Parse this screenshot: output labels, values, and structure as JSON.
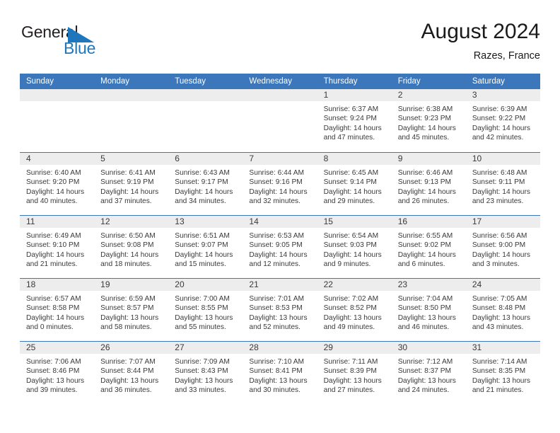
{
  "brand": {
    "name_part1": "General",
    "name_part2": "Blue",
    "color_dark": "#231f20",
    "color_blue": "#1e77bc"
  },
  "header": {
    "title": "August 2024",
    "location": "Razes, France"
  },
  "theme": {
    "header_blue": "#3b77ba",
    "day_band_gray": "#ededed",
    "text": "#3a3a3a"
  },
  "weekdays": [
    "Sunday",
    "Monday",
    "Tuesday",
    "Wednesday",
    "Thursday",
    "Friday",
    "Saturday"
  ],
  "weeks": [
    [
      {
        "day": "",
        "sunrise": "",
        "sunset": "",
        "daylight1": "",
        "daylight2": ""
      },
      {
        "day": "",
        "sunrise": "",
        "sunset": "",
        "daylight1": "",
        "daylight2": ""
      },
      {
        "day": "",
        "sunrise": "",
        "sunset": "",
        "daylight1": "",
        "daylight2": ""
      },
      {
        "day": "",
        "sunrise": "",
        "sunset": "",
        "daylight1": "",
        "daylight2": ""
      },
      {
        "day": "1",
        "sunrise": "Sunrise: 6:37 AM",
        "sunset": "Sunset: 9:24 PM",
        "daylight1": "Daylight: 14 hours",
        "daylight2": "and 47 minutes."
      },
      {
        "day": "2",
        "sunrise": "Sunrise: 6:38 AM",
        "sunset": "Sunset: 9:23 PM",
        "daylight1": "Daylight: 14 hours",
        "daylight2": "and 45 minutes."
      },
      {
        "day": "3",
        "sunrise": "Sunrise: 6:39 AM",
        "sunset": "Sunset: 9:22 PM",
        "daylight1": "Daylight: 14 hours",
        "daylight2": "and 42 minutes."
      }
    ],
    [
      {
        "day": "4",
        "sunrise": "Sunrise: 6:40 AM",
        "sunset": "Sunset: 9:20 PM",
        "daylight1": "Daylight: 14 hours",
        "daylight2": "and 40 minutes."
      },
      {
        "day": "5",
        "sunrise": "Sunrise: 6:41 AM",
        "sunset": "Sunset: 9:19 PM",
        "daylight1": "Daylight: 14 hours",
        "daylight2": "and 37 minutes."
      },
      {
        "day": "6",
        "sunrise": "Sunrise: 6:43 AM",
        "sunset": "Sunset: 9:17 PM",
        "daylight1": "Daylight: 14 hours",
        "daylight2": "and 34 minutes."
      },
      {
        "day": "7",
        "sunrise": "Sunrise: 6:44 AM",
        "sunset": "Sunset: 9:16 PM",
        "daylight1": "Daylight: 14 hours",
        "daylight2": "and 32 minutes."
      },
      {
        "day": "8",
        "sunrise": "Sunrise: 6:45 AM",
        "sunset": "Sunset: 9:14 PM",
        "daylight1": "Daylight: 14 hours",
        "daylight2": "and 29 minutes."
      },
      {
        "day": "9",
        "sunrise": "Sunrise: 6:46 AM",
        "sunset": "Sunset: 9:13 PM",
        "daylight1": "Daylight: 14 hours",
        "daylight2": "and 26 minutes."
      },
      {
        "day": "10",
        "sunrise": "Sunrise: 6:48 AM",
        "sunset": "Sunset: 9:11 PM",
        "daylight1": "Daylight: 14 hours",
        "daylight2": "and 23 minutes."
      }
    ],
    [
      {
        "day": "11",
        "sunrise": "Sunrise: 6:49 AM",
        "sunset": "Sunset: 9:10 PM",
        "daylight1": "Daylight: 14 hours",
        "daylight2": "and 21 minutes."
      },
      {
        "day": "12",
        "sunrise": "Sunrise: 6:50 AM",
        "sunset": "Sunset: 9:08 PM",
        "daylight1": "Daylight: 14 hours",
        "daylight2": "and 18 minutes."
      },
      {
        "day": "13",
        "sunrise": "Sunrise: 6:51 AM",
        "sunset": "Sunset: 9:07 PM",
        "daylight1": "Daylight: 14 hours",
        "daylight2": "and 15 minutes."
      },
      {
        "day": "14",
        "sunrise": "Sunrise: 6:53 AM",
        "sunset": "Sunset: 9:05 PM",
        "daylight1": "Daylight: 14 hours",
        "daylight2": "and 12 minutes."
      },
      {
        "day": "15",
        "sunrise": "Sunrise: 6:54 AM",
        "sunset": "Sunset: 9:03 PM",
        "daylight1": "Daylight: 14 hours",
        "daylight2": "and 9 minutes."
      },
      {
        "day": "16",
        "sunrise": "Sunrise: 6:55 AM",
        "sunset": "Sunset: 9:02 PM",
        "daylight1": "Daylight: 14 hours",
        "daylight2": "and 6 minutes."
      },
      {
        "day": "17",
        "sunrise": "Sunrise: 6:56 AM",
        "sunset": "Sunset: 9:00 PM",
        "daylight1": "Daylight: 14 hours",
        "daylight2": "and 3 minutes."
      }
    ],
    [
      {
        "day": "18",
        "sunrise": "Sunrise: 6:57 AM",
        "sunset": "Sunset: 8:58 PM",
        "daylight1": "Daylight: 14 hours",
        "daylight2": "and 0 minutes."
      },
      {
        "day": "19",
        "sunrise": "Sunrise: 6:59 AM",
        "sunset": "Sunset: 8:57 PM",
        "daylight1": "Daylight: 13 hours",
        "daylight2": "and 58 minutes."
      },
      {
        "day": "20",
        "sunrise": "Sunrise: 7:00 AM",
        "sunset": "Sunset: 8:55 PM",
        "daylight1": "Daylight: 13 hours",
        "daylight2": "and 55 minutes."
      },
      {
        "day": "21",
        "sunrise": "Sunrise: 7:01 AM",
        "sunset": "Sunset: 8:53 PM",
        "daylight1": "Daylight: 13 hours",
        "daylight2": "and 52 minutes."
      },
      {
        "day": "22",
        "sunrise": "Sunrise: 7:02 AM",
        "sunset": "Sunset: 8:52 PM",
        "daylight1": "Daylight: 13 hours",
        "daylight2": "and 49 minutes."
      },
      {
        "day": "23",
        "sunrise": "Sunrise: 7:04 AM",
        "sunset": "Sunset: 8:50 PM",
        "daylight1": "Daylight: 13 hours",
        "daylight2": "and 46 minutes."
      },
      {
        "day": "24",
        "sunrise": "Sunrise: 7:05 AM",
        "sunset": "Sunset: 8:48 PM",
        "daylight1": "Daylight: 13 hours",
        "daylight2": "and 43 minutes."
      }
    ],
    [
      {
        "day": "25",
        "sunrise": "Sunrise: 7:06 AM",
        "sunset": "Sunset: 8:46 PM",
        "daylight1": "Daylight: 13 hours",
        "daylight2": "and 39 minutes."
      },
      {
        "day": "26",
        "sunrise": "Sunrise: 7:07 AM",
        "sunset": "Sunset: 8:44 PM",
        "daylight1": "Daylight: 13 hours",
        "daylight2": "and 36 minutes."
      },
      {
        "day": "27",
        "sunrise": "Sunrise: 7:09 AM",
        "sunset": "Sunset: 8:43 PM",
        "daylight1": "Daylight: 13 hours",
        "daylight2": "and 33 minutes."
      },
      {
        "day": "28",
        "sunrise": "Sunrise: 7:10 AM",
        "sunset": "Sunset: 8:41 PM",
        "daylight1": "Daylight: 13 hours",
        "daylight2": "and 30 minutes."
      },
      {
        "day": "29",
        "sunrise": "Sunrise: 7:11 AM",
        "sunset": "Sunset: 8:39 PM",
        "daylight1": "Daylight: 13 hours",
        "daylight2": "and 27 minutes."
      },
      {
        "day": "30",
        "sunrise": "Sunrise: 7:12 AM",
        "sunset": "Sunset: 8:37 PM",
        "daylight1": "Daylight: 13 hours",
        "daylight2": "and 24 minutes."
      },
      {
        "day": "31",
        "sunrise": "Sunrise: 7:14 AM",
        "sunset": "Sunset: 8:35 PM",
        "daylight1": "Daylight: 13 hours",
        "daylight2": "and 21 minutes."
      }
    ]
  ]
}
